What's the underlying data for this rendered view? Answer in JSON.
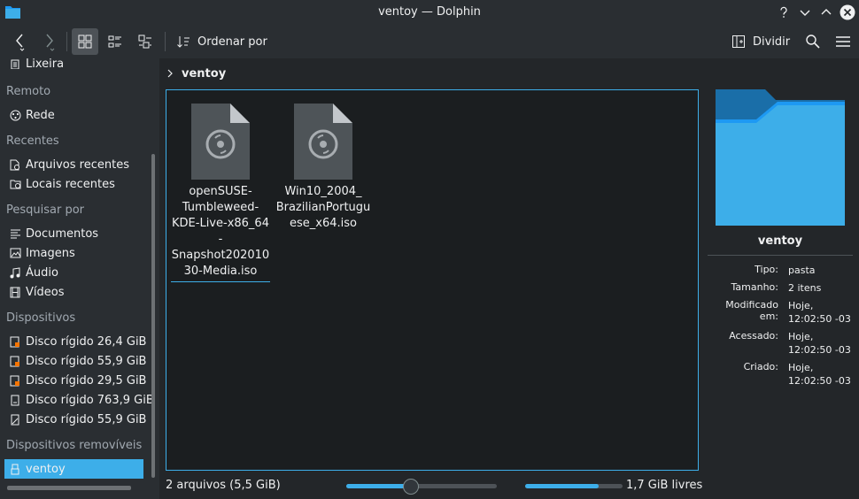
{
  "window": {
    "title": "ventoy — Dolphin"
  },
  "toolbar": {
    "sort_label": "Ordenar por",
    "split_label": "Dividir"
  },
  "sidebar": {
    "trash": "Lixeira",
    "remote_header": "Remoto",
    "network": "Rede",
    "recent_header": "Recentes",
    "recent_files": "Arquivos recentes",
    "recent_locations": "Locais recentes",
    "search_header": "Pesquisar por",
    "documents": "Documentos",
    "images": "Imagens",
    "audio": "Áudio",
    "videos": "Vídeos",
    "devices_header": "Dispositivos",
    "devices": [
      "Disco rígido 26,4 GiB",
      "Disco rígido 55,9 GiB",
      "Disco rígido 29,5 GiB",
      "Disco rígido 763,9 GiB",
      "Disco rígido 55,9 GiB"
    ],
    "removable_header": "Dispositivos removíveis",
    "removable": "ventoy"
  },
  "breadcrumb": {
    "current": "ventoy"
  },
  "files": [
    {
      "name": "openSUSE-Tumbleweed-KDE-Live-x86_64-Snapshot20201030-Media.iso",
      "display": "openSUSE-\nTumbleweed-\nKDE-Live-x86_64-\nSnapshot202010\n30-Media.iso"
    },
    {
      "name": "Win10_2004_BrazilianPortuguese_x64.iso",
      "display": "Win10_2004_\nBrazilianPortugu\nese_x64.iso"
    }
  ],
  "statusbar": {
    "summary": "2 arquivos (5,5 GiB)",
    "free_space": "1,7 GiB livres",
    "zoom_level": 0.43,
    "space_used": 0.75
  },
  "info": {
    "title": "ventoy",
    "type_label": "Tipo:",
    "type_value": "pasta",
    "size_label": "Tamanho:",
    "size_value": "2 itens",
    "modified_label": "Modificado em:",
    "modified_value": "Hoje,\n12:02:50 -03",
    "accessed_label": "Acessado:",
    "accessed_value": "Hoje,\n12:02:50 -03",
    "created_label": "Criado:",
    "created_value": "Hoje,\n12:02:50 -03"
  },
  "colors": {
    "accent": "#3daee9",
    "background": "#232629",
    "view": "#1b1e20"
  }
}
